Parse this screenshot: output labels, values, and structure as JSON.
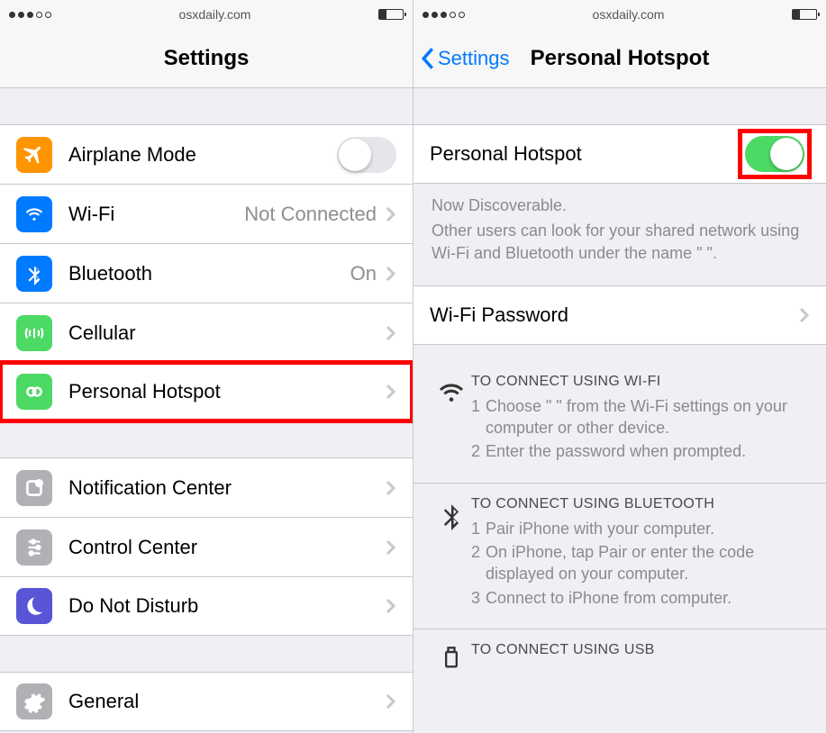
{
  "status": {
    "url": "osxdaily.com"
  },
  "left": {
    "title": "Settings",
    "items_group1": [
      {
        "name": "airplane-mode",
        "label": "Airplane Mode",
        "detail": "",
        "type": "toggle",
        "on": false
      },
      {
        "name": "wifi",
        "label": "Wi-Fi",
        "detail": "Not Connected",
        "type": "link"
      },
      {
        "name": "bluetooth",
        "label": "Bluetooth",
        "detail": "On",
        "type": "link"
      },
      {
        "name": "cellular",
        "label": "Cellular",
        "detail": "",
        "type": "link"
      },
      {
        "name": "personal-hotspot",
        "label": "Personal Hotspot",
        "detail": "",
        "type": "link",
        "highlight": true
      }
    ],
    "items_group2": [
      {
        "name": "notification-center",
        "label": "Notification Center"
      },
      {
        "name": "control-center",
        "label": "Control Center"
      },
      {
        "name": "do-not-disturb",
        "label": "Do Not Disturb"
      }
    ],
    "items_group3": [
      {
        "name": "general",
        "label": "General"
      }
    ]
  },
  "right": {
    "back": "Settings",
    "title": "Personal Hotspot",
    "toggle_label": "Personal Hotspot",
    "toggle_on": true,
    "discoverable_title": "Now Discoverable.",
    "discoverable_body": "Other users can look for your shared network using Wi-Fi and Bluetooth under the name \"                          \".",
    "wifi_pw_label": "Wi-Fi Password",
    "instr_wifi_title": "TO CONNECT USING WI-FI",
    "instr_wifi_steps": [
      "Choose \"                          \" from the Wi-Fi settings on your computer or other device.",
      "Enter the password when prompted."
    ],
    "instr_bt_title": "TO CONNECT USING BLUETOOTH",
    "instr_bt_steps": [
      "Pair iPhone with your computer.",
      "On iPhone, tap Pair or enter the code displayed on your computer.",
      "Connect to iPhone from computer."
    ],
    "instr_usb_title": "TO CONNECT USING USB"
  }
}
